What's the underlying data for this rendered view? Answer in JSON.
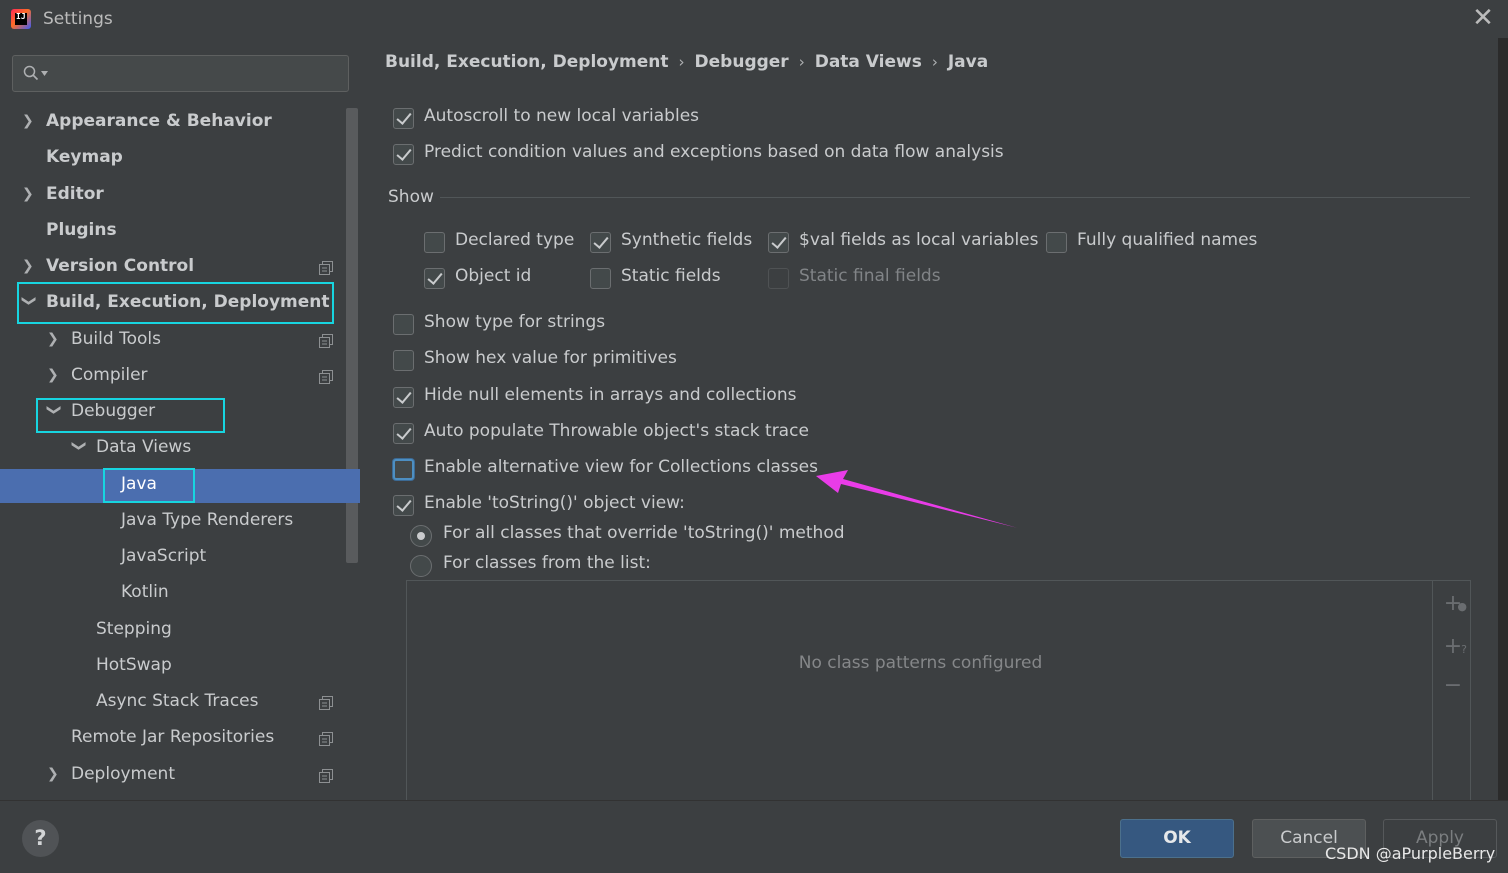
{
  "window": {
    "title": "Settings",
    "close": "✕"
  },
  "search": {
    "value": "",
    "placeholder": ""
  },
  "sidebar": {
    "items": [
      {
        "label": "Appearance & Behavior"
      },
      {
        "label": "Keymap"
      },
      {
        "label": "Editor"
      },
      {
        "label": "Plugins"
      },
      {
        "label": "Version Control"
      },
      {
        "label": "Build, Execution, Deployment"
      },
      {
        "label": "Build Tools"
      },
      {
        "label": "Compiler"
      },
      {
        "label": "Debugger"
      },
      {
        "label": "Data Views"
      },
      {
        "label": "Java"
      },
      {
        "label": "Java Type Renderers"
      },
      {
        "label": "JavaScript"
      },
      {
        "label": "Kotlin"
      },
      {
        "label": "Stepping"
      },
      {
        "label": "HotSwap"
      },
      {
        "label": "Async Stack Traces"
      },
      {
        "label": "Remote Jar Repositories"
      },
      {
        "label": "Deployment"
      }
    ]
  },
  "breadcrumb": [
    "Build, Execution, Deployment",
    "Debugger",
    "Data Views",
    "Java"
  ],
  "options": {
    "autoscroll": {
      "label": "Autoscroll to new local variables",
      "checked": true
    },
    "predict": {
      "label": "Predict condition values and exceptions based on data flow analysis",
      "checked": true
    },
    "show_title": "Show",
    "declared_type": {
      "label": "Declared type",
      "checked": false
    },
    "synthetic_fields": {
      "label": "Synthetic fields",
      "checked": true
    },
    "val_fields": {
      "label": "$val fields as local variables",
      "checked": true
    },
    "fully_qualified": {
      "label": "Fully qualified names",
      "checked": false
    },
    "object_id": {
      "label": "Object id",
      "checked": true
    },
    "static_fields": {
      "label": "Static fields",
      "checked": false
    },
    "static_final_fields": {
      "label": "Static final fields",
      "checked": false,
      "disabled": true
    },
    "type_for_strings": {
      "label": "Show type for strings",
      "checked": false
    },
    "hex_value": {
      "label": "Show hex value for primitives",
      "checked": false
    },
    "hide_null": {
      "label": "Hide null elements in arrays and collections",
      "checked": true
    },
    "auto_populate": {
      "label": "Auto populate Throwable object's stack trace",
      "checked": true
    },
    "alt_view": {
      "label": "Enable alternative view for Collections classes",
      "checked": false
    },
    "tostring_view": {
      "label": "Enable 'toString()' object view:",
      "checked": true
    },
    "radio_all": {
      "label": "For all classes that override 'toString()' method",
      "selected": true
    },
    "radio_list": {
      "label": "For classes from the list:",
      "selected": false
    }
  },
  "class_list": {
    "empty_text": "No class patterns configured"
  },
  "buttons": {
    "help": "?",
    "ok": "OK",
    "cancel": "Cancel",
    "apply": "Apply"
  },
  "watermark": "CSDN @aPurpleBerry",
  "colors": {
    "selection": "#4b6eaf",
    "highlight_box": "#17d5e0",
    "annotation_arrow": "#e93ce8",
    "ok_button": "#365880"
  }
}
